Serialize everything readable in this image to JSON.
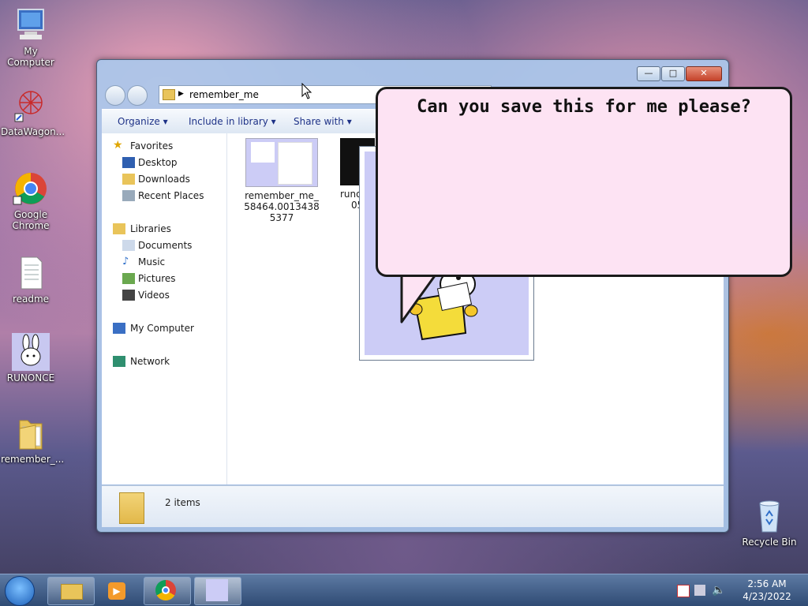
{
  "desktop": {
    "icons": [
      {
        "label": "My Computer"
      },
      {
        "label": "DataWagon..."
      },
      {
        "label": "Google Chrome"
      },
      {
        "label": "readme"
      },
      {
        "label": "RUNONCE"
      },
      {
        "label": "remember_..."
      },
      {
        "label": "Recycle Bin"
      }
    ]
  },
  "explorer": {
    "address": "remember_me",
    "toolbar": {
      "organize": "Organize",
      "include": "Include in library",
      "share": "Share with"
    },
    "nav": {
      "favorites": "Favorites",
      "desktop": "Desktop",
      "downloads": "Downloads",
      "recent": "Recent Places",
      "libraries": "Libraries",
      "documents": "Documents",
      "music": "Music",
      "pictures": "Pictures",
      "videos": "Videos",
      "computer": "My Computer",
      "network": "Network"
    },
    "files": [
      {
        "name": "remember_me_58464.00134385377"
      },
      {
        "name": "runo"
      },
      {
        "name": "05"
      }
    ],
    "status": "2 items"
  },
  "bubble": {
    "text": "Can you save this for me please?"
  },
  "taskbar": {
    "time": "2:56 AM",
    "date": "4/23/2022"
  }
}
